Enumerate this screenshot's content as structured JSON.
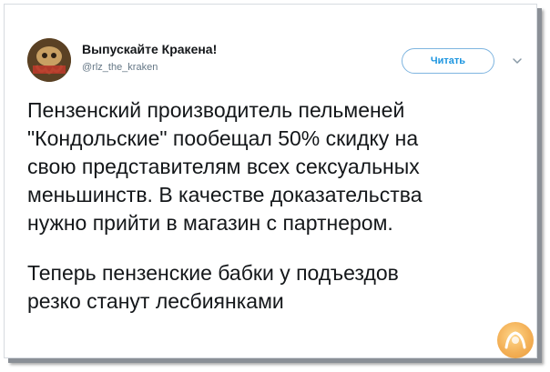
{
  "tweet": {
    "author": {
      "display_name": "Выпускайте Кракена!",
      "handle": "@rlz_the_kraken",
      "avatar_icon": "kraken-avatar-icon"
    },
    "follow_label": "Читать",
    "menu_icon": "chevron-down-icon",
    "paragraphs": [
      "Пензенский производитель пельменей\n\"Кондольские\" пообещал 50% скидку на\nсвою представителям всех сексуальных\nменьшинств. В качестве доказательства\nнужно прийти в магазин с партнером.",
      "Теперь пензенские бабки у подъездов\nрезко станут лесбиянками"
    ]
  },
  "colors": {
    "accent": "#1b95e0",
    "text": "#14171a",
    "secondary": "#657786"
  },
  "watermark_icon": "site-watermark-logo-icon"
}
